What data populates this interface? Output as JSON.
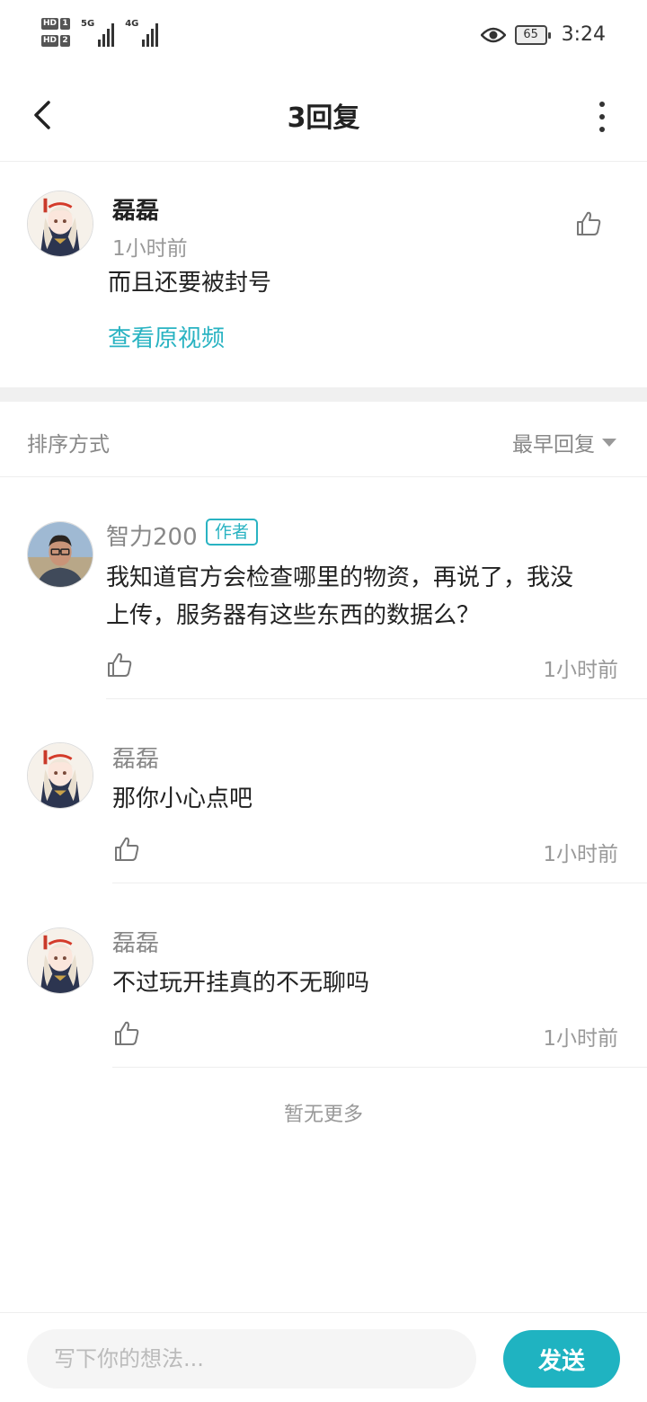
{
  "status_bar": {
    "sim1_tag": "HD",
    "sim1_num": "1",
    "sim2_tag": "HD",
    "sim2_num": "2",
    "net1": "5G",
    "net2": "4G",
    "battery": "65",
    "time": "3:24"
  },
  "header": {
    "title": "3回复"
  },
  "original_comment": {
    "user": "磊磊",
    "time": "1小时前",
    "text": "而且还要被封号",
    "view_video_link": "查看原视频"
  },
  "sort": {
    "label": "排序方式",
    "selected": "最早回复"
  },
  "replies": [
    {
      "user": "智力200",
      "badge": "作者",
      "text_line1": "我知道官方会检查哪里的物资，再说了，我没",
      "text_line2": "上传，服务器有这些东西的数据么？",
      "time": "1小时前"
    },
    {
      "user": "磊磊",
      "text": "那你小心点吧",
      "time": "1小时前"
    },
    {
      "user": "磊磊",
      "text": "不过玩开挂真的不无聊吗",
      "time": "1小时前"
    }
  ],
  "no_more": "暂无更多",
  "composer": {
    "placeholder": "写下你的想法...",
    "send_label": "发送"
  },
  "colors": {
    "accent": "#29b3c2",
    "send_button": "#1fb3c1"
  }
}
